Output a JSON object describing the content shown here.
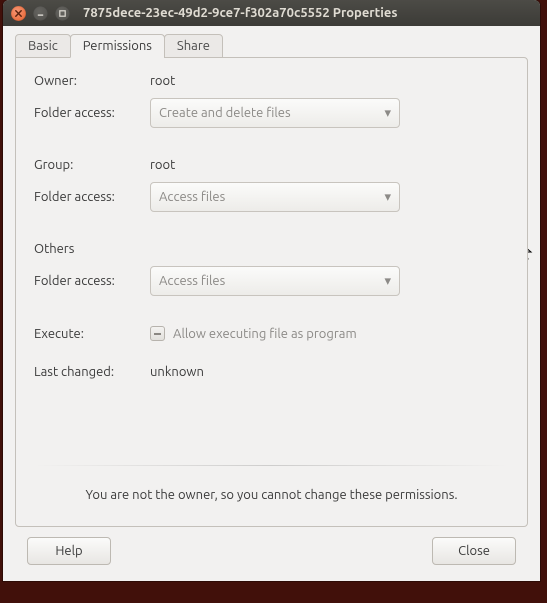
{
  "window": {
    "title": "7875dece-23ec-49d2-9ce7-f302a70c5552 Properties"
  },
  "tabs": {
    "basic": "Basic",
    "permissions": "Permissions",
    "share": "Share"
  },
  "perm": {
    "owner_label": "Owner:",
    "owner_value": "root",
    "owner_access_label": "Folder access:",
    "owner_access_value": "Create and delete files",
    "group_label": "Group:",
    "group_value": "root",
    "group_access_label": "Folder access:",
    "group_access_value": "Access files",
    "others_label": "Others",
    "others_access_label": "Folder access:",
    "others_access_value": "Access files",
    "execute_label": "Execute:",
    "execute_check_label": "Allow executing file as program",
    "lastchanged_label": "Last changed:",
    "lastchanged_value": "unknown"
  },
  "notice": "You are not the owner, so you cannot change these permissions.",
  "buttons": {
    "help": "Help",
    "close": "Close"
  }
}
